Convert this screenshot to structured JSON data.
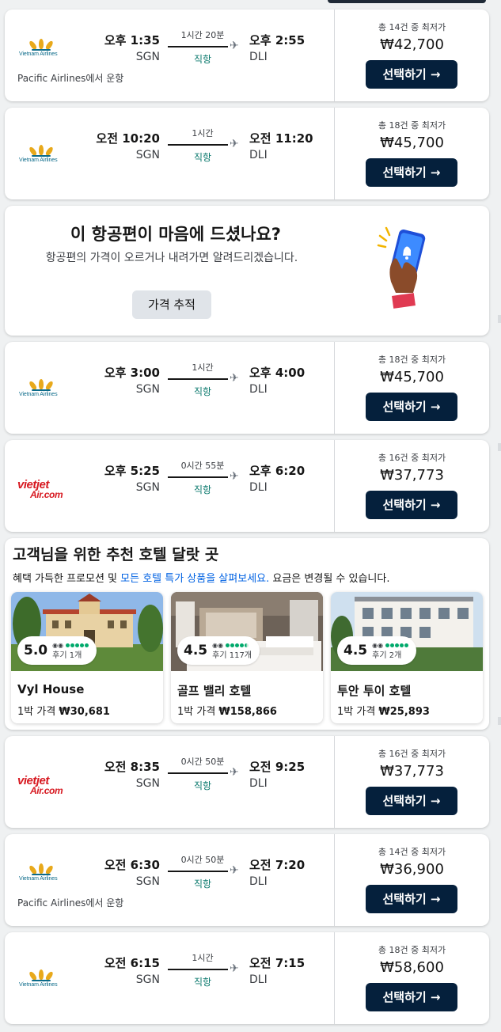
{
  "flights": [
    {
      "airline": "Vietnam Airlines",
      "logo": "vietnam-airlines",
      "dep_time": "오후 1:35",
      "dep_code": "SGN",
      "duration": "1시간 20분",
      "stops": "직항",
      "arr_time": "오후 2:55",
      "arr_code": "DLI",
      "operated_by": "Pacific Airlines에서 운항",
      "deals": "총 14건 중 최저가",
      "price": "₩42,700",
      "select_label": "선택하기 →"
    },
    {
      "airline": "Vietnam Airlines",
      "logo": "vietnam-airlines",
      "dep_time": "오전 10:20",
      "dep_code": "SGN",
      "duration": "1시간",
      "stops": "직항",
      "arr_time": "오전 11:20",
      "arr_code": "DLI",
      "operated_by": "",
      "deals": "총 18건 중 최저가",
      "price": "₩45,700",
      "select_label": "선택하기 →"
    },
    {
      "airline": "Vietnam Airlines",
      "logo": "vietnam-airlines",
      "dep_time": "오후 3:00",
      "dep_code": "SGN",
      "duration": "1시간",
      "stops": "직항",
      "arr_time": "오후 4:00",
      "arr_code": "DLI",
      "operated_by": "",
      "deals": "총 18건 중 최저가",
      "price": "₩45,700",
      "select_label": "선택하기 →"
    },
    {
      "airline": "VietJet Air",
      "logo": "vietjet-air",
      "dep_time": "오후 5:25",
      "dep_code": "SGN",
      "duration": "0시간 55분",
      "stops": "직항",
      "arr_time": "오후 6:20",
      "arr_code": "DLI",
      "operated_by": "",
      "deals": "총 16건 중 최저가",
      "price": "₩37,773",
      "select_label": "선택하기 →"
    },
    {
      "airline": "VietJet Air",
      "logo": "vietjet-air",
      "dep_time": "오전 8:35",
      "dep_code": "SGN",
      "duration": "0시간 50분",
      "stops": "직항",
      "arr_time": "오전 9:25",
      "arr_code": "DLI",
      "operated_by": "",
      "deals": "총 16건 중 최저가",
      "price": "₩37,773",
      "select_label": "선택하기 →"
    },
    {
      "airline": "Vietnam Airlines",
      "logo": "vietnam-airlines",
      "dep_time": "오전 6:30",
      "dep_code": "SGN",
      "duration": "0시간 50분",
      "stops": "직항",
      "arr_time": "오전 7:20",
      "arr_code": "DLI",
      "operated_by": "Pacific Airlines에서 운항",
      "deals": "총 14건 중 최저가",
      "price": "₩36,900",
      "select_label": "선택하기 →"
    },
    {
      "airline": "Vietnam Airlines",
      "logo": "vietnam-airlines",
      "dep_time": "오전 6:15",
      "dep_code": "SGN",
      "duration": "1시간",
      "stops": "직항",
      "arr_time": "오전 7:15",
      "arr_code": "DLI",
      "operated_by": "",
      "deals": "총 18건 중 최저가",
      "price": "₩58,600",
      "select_label": "선택하기 →"
    }
  ],
  "logos": {
    "vietnam_airlines_text": "Vietnam Airlines",
    "vietjet_line1": "vietjet",
    "vietjet_line2": "Air.com"
  },
  "price_alert": {
    "title": "이 항공편이 마음에 드셨나요?",
    "subtitle": "항공편의 가격이 오르거나 내려가면 알려드리겠습니다.",
    "button": "가격 추적",
    "icon": "phone-notification-icon"
  },
  "hotels_section": {
    "title": "고객님을 위한 추천 호텔 달랏 곳",
    "sub_prefix": "혜택 가득한 프로모션 및 ",
    "sub_link": "모든 호텔 특가 상품을 살펴보세요.",
    "sub_suffix": " 요금은 변경될 수 있습니다.",
    "price_prefix": "1박 가격 ",
    "review_prefix": "후기 ",
    "hotels": [
      {
        "name": "Vyl House",
        "rating": "5.0",
        "reviews": "1개",
        "price": "₩30,681",
        "dots": 5
      },
      {
        "name": "골프 밸리 호텔",
        "rating": "4.5",
        "reviews": "117개",
        "price": "₩158,866",
        "dots": 4.5
      },
      {
        "name": "투안 투이 호텔",
        "rating": "4.5",
        "reviews": "2개",
        "price": "₩25,893",
        "dots": 5
      }
    ]
  },
  "colors": {
    "select_button": "#05203c",
    "stops_green": "#0c7a6e",
    "link_blue": "#0062e3",
    "tripadvisor_green": "#00aa6c",
    "vietjet_red": "#d71921",
    "vietnam_airlines_gold": "#e8a91b"
  }
}
